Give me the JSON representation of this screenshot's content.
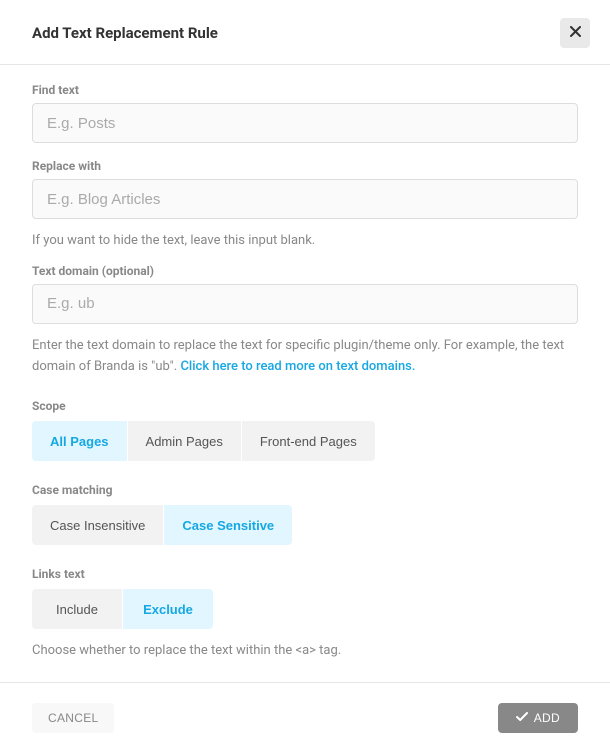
{
  "header": {
    "title": "Add Text Replacement Rule"
  },
  "fields": {
    "find": {
      "label": "Find text",
      "placeholder": "E.g. Posts",
      "value": ""
    },
    "replace": {
      "label": "Replace with",
      "placeholder": "E.g. Blog Articles",
      "value": "",
      "help": "If you want to hide the text, leave this input blank."
    },
    "domain": {
      "label": "Text domain (optional)",
      "placeholder": "E.g. ub",
      "value": "",
      "help_prefix": "Enter the text domain to replace the text for specific plugin/theme only. For example, the text domain of Branda is \"ub\". ",
      "help_link": "Click here to read more on text domains."
    }
  },
  "scope": {
    "label": "Scope",
    "options": [
      "All Pages",
      "Admin Pages",
      "Front-end Pages"
    ],
    "selected": 0
  },
  "case_matching": {
    "label": "Case matching",
    "options": [
      "Case Insensitive",
      "Case Sensitive"
    ],
    "selected": 1
  },
  "links_text": {
    "label": "Links text",
    "options": [
      "Include",
      "Exclude"
    ],
    "selected": 1,
    "help": "Choose whether to replace the text within the <a> tag."
  },
  "footer": {
    "cancel": "CANCEL",
    "add": "ADD"
  }
}
